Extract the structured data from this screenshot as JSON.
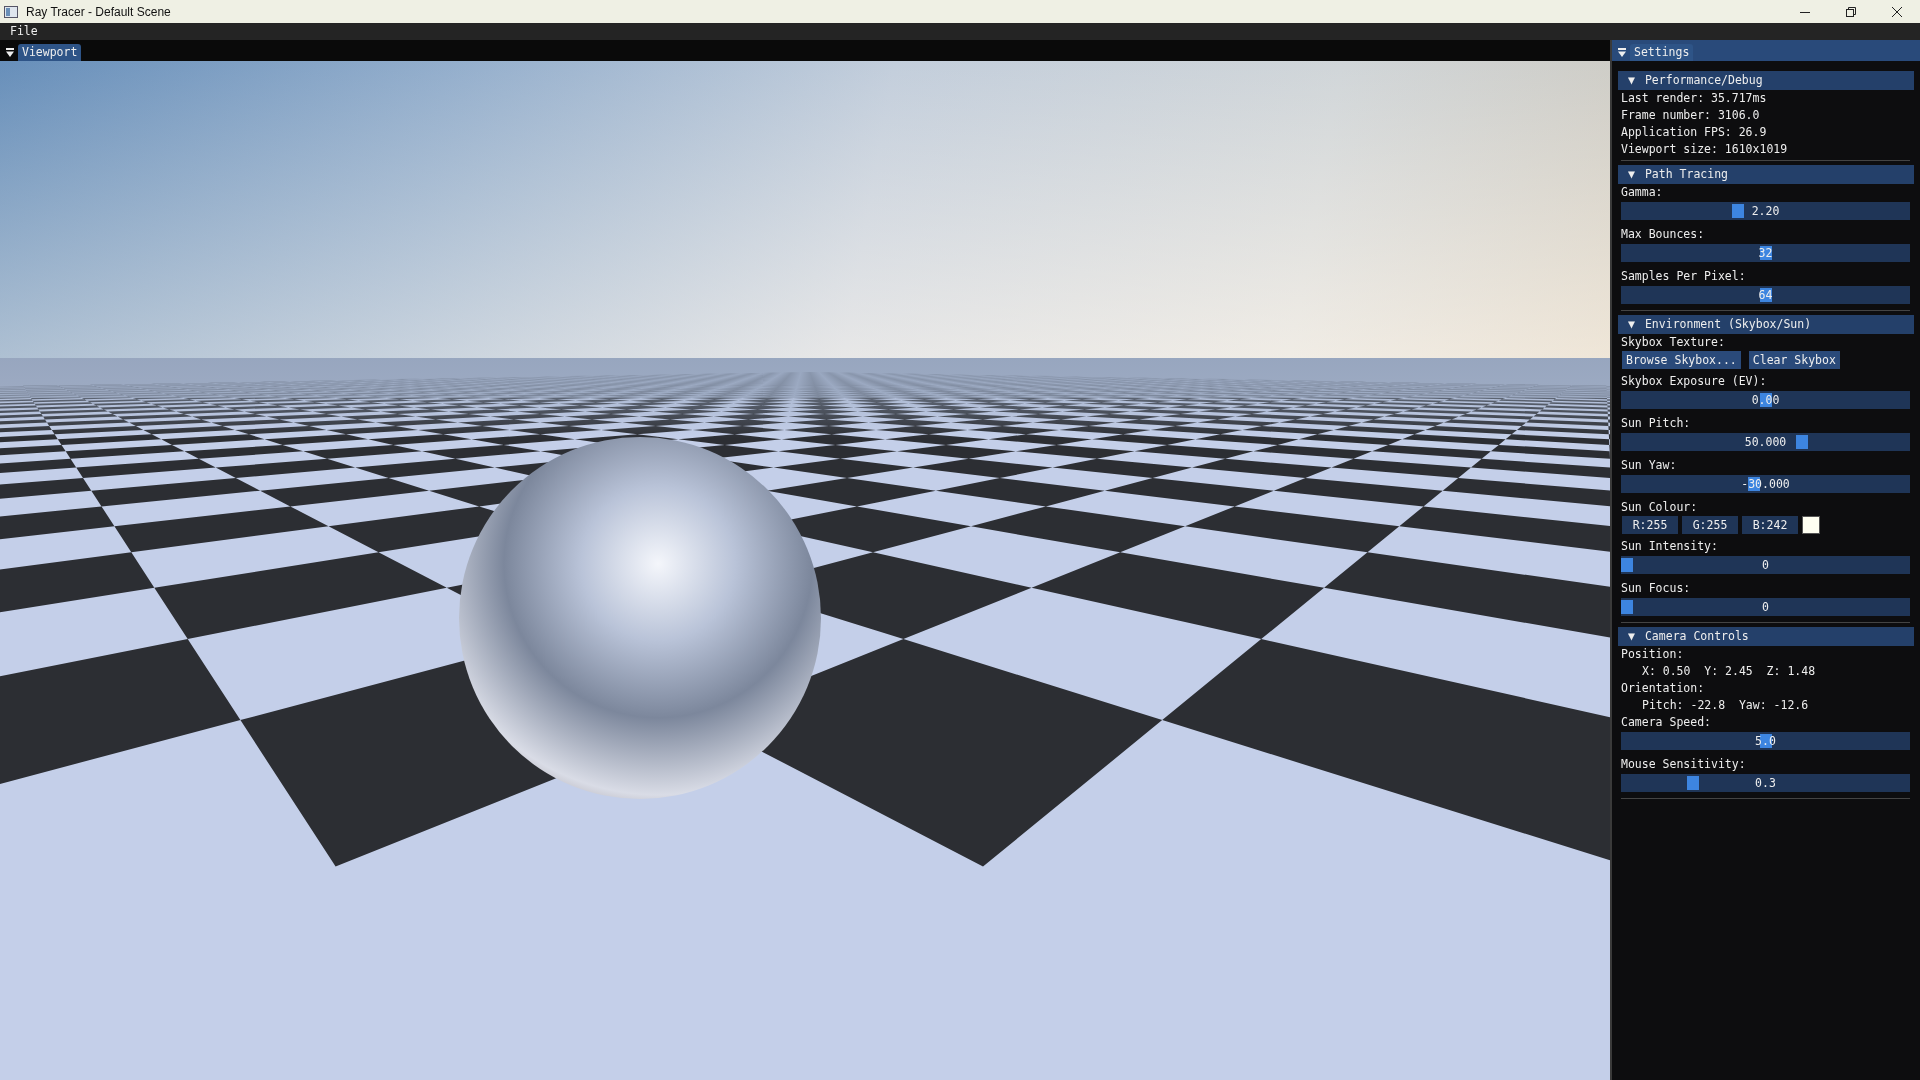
{
  "window": {
    "title": "Ray Tracer - Default Scene"
  },
  "menu": [
    "File"
  ],
  "viewport": {
    "tab": "Viewport"
  },
  "settings": {
    "tab": "Settings",
    "sections": [
      {
        "arrow": "▼",
        "title": "Performance/Debug",
        "items": [
          {
            "kind": "text",
            "text": "Last render: 35.717ms"
          },
          {
            "kind": "text",
            "text": "Frame number: 3106.0"
          },
          {
            "kind": "text",
            "text": "Application FPS: 26.9"
          },
          {
            "kind": "text",
            "text": "Viewport size: 1610x1019"
          }
        ]
      },
      {
        "arrow": "▼",
        "title": "Path Tracing",
        "items": [
          {
            "kind": "label",
            "text": "Gamma:"
          },
          {
            "kind": "slider",
            "value": "2.20",
            "level": 0.4
          },
          {
            "kind": "label",
            "text": "Max Bounces:"
          },
          {
            "kind": "slider",
            "value": "32",
            "level": 0.5
          },
          {
            "kind": "label",
            "text": "Samples Per Pixel:"
          },
          {
            "kind": "slider",
            "value": "64",
            "level": 0.5
          }
        ]
      },
      {
        "arrow": "▼",
        "title": "Environment (Skybox/Sun)",
        "items": [
          {
            "kind": "label",
            "text": "Skybox Texture:"
          },
          {
            "kind": "buttons",
            "buttons": [
              "Browse Skybox...",
              "Clear Skybox"
            ]
          },
          {
            "kind": "label",
            "text": "Skybox Exposure (EV):"
          },
          {
            "kind": "slider",
            "value": "0.00",
            "level": 0.5
          },
          {
            "kind": "label",
            "text": "Sun Pitch:"
          },
          {
            "kind": "slider",
            "value": "50.000",
            "level": 0.63
          },
          {
            "kind": "label",
            "text": "Sun Yaw:"
          },
          {
            "kind": "slider",
            "value": "-30.000",
            "level": 0.46
          },
          {
            "kind": "label",
            "text": "Sun Colour:"
          },
          {
            "kind": "color",
            "channels": [
              "R:255",
              "G:255",
              "B:242"
            ],
            "color": "#fffff2"
          },
          {
            "kind": "label",
            "text": "Sun Intensity:"
          },
          {
            "kind": "slider",
            "value": "0",
            "level": 0
          },
          {
            "kind": "label",
            "text": "Sun Focus:"
          },
          {
            "kind": "slider",
            "value": "0",
            "level": 0
          }
        ]
      },
      {
        "arrow": "▼",
        "title": "Camera Controls",
        "items": [
          {
            "kind": "label",
            "text": "Position:",
            "children": [
              {
                "kind": "text",
                "text": "X: 0.50  Y: 2.45  Z: 1.48"
              }
            ]
          },
          {
            "kind": "label",
            "text": "Orientation:",
            "children": [
              {
                "kind": "text",
                "text": "Pitch: -22.8  Yaw: -12.6"
              }
            ]
          },
          {
            "kind": "label",
            "text": "Camera Speed:"
          },
          {
            "kind": "slider",
            "value": "5.0",
            "level": 0.5
          },
          {
            "kind": "label",
            "text": "Mouse Sensitivity:"
          },
          {
            "kind": "slider",
            "value": "0.3",
            "level": 0.24
          }
        ]
      }
    ]
  }
}
